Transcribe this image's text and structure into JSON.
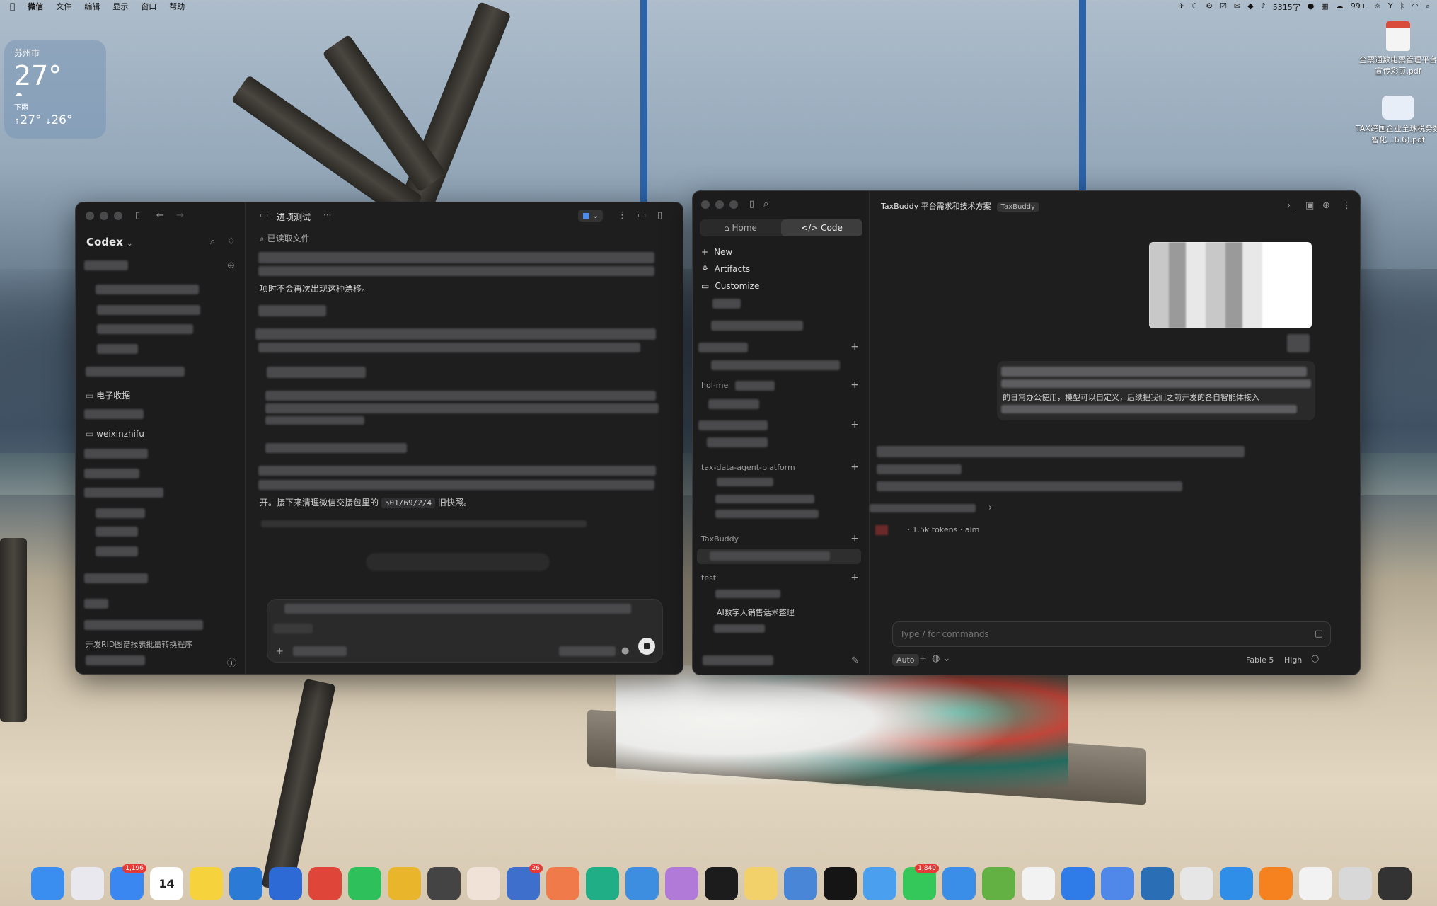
{
  "menubar": {
    "items": [
      "微信",
      "文件",
      "编辑",
      "显示",
      "窗口",
      "帮助"
    ],
    "status_word_count": "5315字",
    "status_badge": "99+"
  },
  "weather": {
    "city": "苏州市",
    "temperature": "27°",
    "condition": "下雨",
    "high": "27°",
    "low": "26°"
  },
  "desktop_files": [
    {
      "name": "全票通数电票管理平台宣传彩页.pdf",
      "icon_color": "#d94b3b"
    },
    {
      "name": "TAX跨国企业全球税务数智化...6.6).pdf",
      "icon_color": "#2d6fd1"
    }
  ],
  "codex": {
    "app_name": "Codex",
    "folders": [
      "电子收据",
      "weixinzhifu"
    ],
    "thread_title": "进项测试",
    "more_label": "···",
    "read_files_label": "已读取文件",
    "message_line1": "项时不会再次出现这种漂移。",
    "message_line2_prefix": "开。接下来清理微信交接包里的",
    "message_code": "501/69/2/4",
    "message_line2_suffix": "旧快照。",
    "sidebar_footer": "开发RID图谱报表批量转换程序"
  },
  "claude": {
    "tabs": {
      "home": "Home",
      "code": "Code"
    },
    "nav": {
      "new": "New",
      "artifacts": "Artifacts",
      "customize": "Customize"
    },
    "sections": {
      "hol": "hol-me",
      "tax_data": "tax-data-agent-platform",
      "taxbuddy": "TaxBuddy",
      "test": "test"
    },
    "test_item": "AI数字人销售话术整理",
    "title": "TaxBuddy 平台需求和技术方案",
    "title_badge": "TaxBuddy",
    "user_message_visible": "的日常办公使用，模型可以自定义，后续把我们之前开发的各自智能体接入",
    "tokens_label": "· 1.5k tokens · alm",
    "input_placeholder": "Type / for commands",
    "mode": "Auto",
    "model": "Fable 5",
    "effort": "High"
  },
  "dock": {
    "badges": {
      "mail": "1,196",
      "calendar": "14",
      "telegram": "26",
      "messages": "1,840"
    },
    "apps": [
      {
        "name": "finder",
        "color": "#3a8ef0"
      },
      {
        "name": "launchpad",
        "color": "#e8e8ee"
      },
      {
        "name": "mail",
        "color": "#3a87f2"
      },
      {
        "name": "calendar",
        "color": "#ffffff"
      },
      {
        "name": "notes",
        "color": "#f6d23c"
      },
      {
        "name": "windows-app",
        "color": "#2b7bd6"
      },
      {
        "name": "cursor",
        "color": "#2d6ad6"
      },
      {
        "name": "wps",
        "color": "#e0453a"
      },
      {
        "name": "wechat",
        "color": "#2ec15b"
      },
      {
        "name": "chrome",
        "color": "#e9b52a"
      },
      {
        "name": "calculator",
        "color": "#444444"
      },
      {
        "name": "avatar-app",
        "color": "#f0e2d6"
      },
      {
        "name": "telegram",
        "color": "#3f6fcc"
      },
      {
        "name": "claude",
        "color": "#f07a4a"
      },
      {
        "name": "chatgpt",
        "color": "#1fae86"
      },
      {
        "name": "box-app",
        "color": "#3d8ee0"
      },
      {
        "name": "gem-app",
        "color": "#b17ad8"
      },
      {
        "name": "dark-app",
        "color": "#1c1c1c"
      },
      {
        "name": "yellow-app",
        "color": "#f2d06a"
      },
      {
        "name": "blue-app",
        "color": "#4a86d8"
      },
      {
        "name": "black-app",
        "color": "#151515"
      },
      {
        "name": "cloud-app",
        "color": "#4aa0ee"
      },
      {
        "name": "messages",
        "color": "#34c759"
      },
      {
        "name": "safari",
        "color": "#3b8ee8"
      },
      {
        "name": "terminal-app",
        "color": "#63b043"
      },
      {
        "name": "doc-app",
        "color": "#f2f2f2"
      },
      {
        "name": "feishu",
        "color": "#2f7be8"
      },
      {
        "name": "bird-app",
        "color": "#4f88e8"
      },
      {
        "name": "db-app",
        "color": "#2a6fb5"
      },
      {
        "name": "ghost-app",
        "color": "#e6e6e6"
      },
      {
        "name": "docker",
        "color": "#2f8ee8"
      },
      {
        "name": "player",
        "color": "#f5821f"
      },
      {
        "name": "preview-1",
        "color": "#f2f2f2"
      },
      {
        "name": "preview-2",
        "color": "#d8d8d8"
      },
      {
        "name": "preview-3",
        "color": "#333333"
      }
    ]
  }
}
